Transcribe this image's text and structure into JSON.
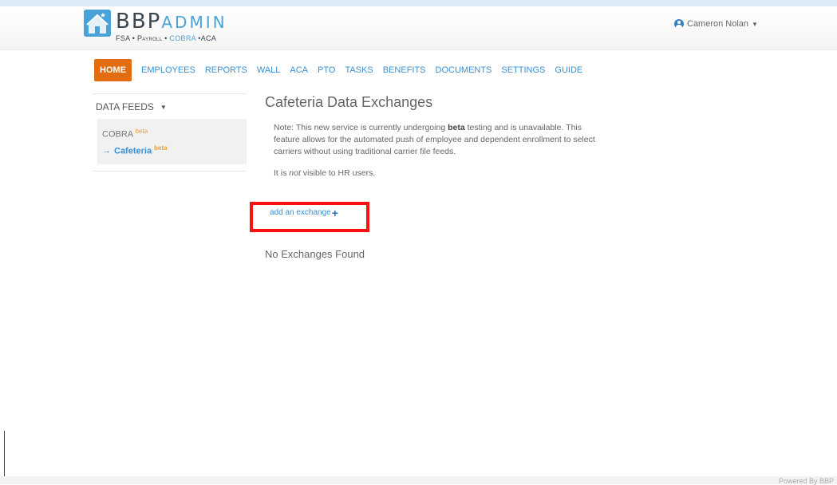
{
  "brand": {
    "name_dark": "BBP",
    "name_light": "ADMIN",
    "tagline": {
      "fsa": "FSA",
      "payroll": "Payroll",
      "cobra": "COBRA",
      "aca": "ACA",
      "sep": "•"
    },
    "accent_color": "#4aa3d8"
  },
  "user": {
    "name": "Cameron Nolan",
    "icon": "user-circle-icon"
  },
  "nav": {
    "items": [
      {
        "label": "HOME",
        "active": true
      },
      {
        "label": "EMPLOYEES",
        "active": false
      },
      {
        "label": "REPORTS",
        "active": false
      },
      {
        "label": "WALL",
        "active": false
      },
      {
        "label": "ACA",
        "active": false
      },
      {
        "label": "PTO",
        "active": false
      },
      {
        "label": "TASKS",
        "active": false
      },
      {
        "label": "BENEFITS",
        "active": false
      },
      {
        "label": "DOCUMENTS",
        "active": false
      },
      {
        "label": "SETTINGS",
        "active": false
      },
      {
        "label": "GUIDE",
        "active": false
      }
    ],
    "active_color": "#e36b10"
  },
  "sidebar": {
    "title": "DATA FEEDS",
    "items": [
      {
        "label": "COBRA",
        "badge": "beta",
        "active": false
      },
      {
        "label": "Cafeteria",
        "badge": "beta",
        "active": true
      }
    ]
  },
  "main": {
    "title": "Cafeteria Data Exchanges",
    "note_prefix": "Note: This new service is currently undergoing ",
    "note_bold": "beta",
    "note_suffix": " testing and is unavailable. This feature allows for the automated push of employee and dependent enrollment to select carriers without using traditional carrier file feeds.",
    "visibility_prefix": "It is ",
    "visibility_em": "not",
    "visibility_suffix": " visible to HR users.",
    "add_label": "add an exchange",
    "empty_label": "No Exchanges Found"
  },
  "footer": {
    "text": "Powered By BBP"
  }
}
